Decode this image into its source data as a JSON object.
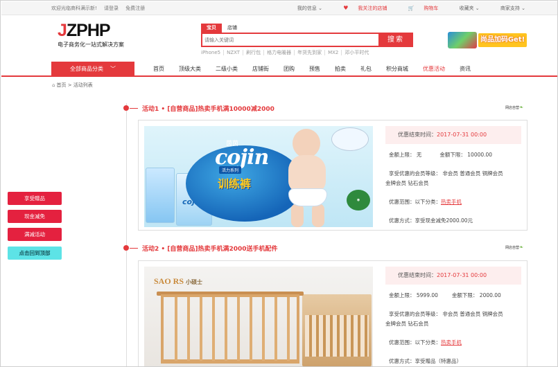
{
  "topbar": {
    "welcome": "欢迎光临商科满示新!",
    "login": "请登录",
    "register": "免费注册",
    "my_info": "我的信息",
    "followed_shops": "我关注的店铺",
    "cart": "购物车",
    "favorites": "收藏夹",
    "seller_center": "商家支持"
  },
  "header": {
    "logo_j": "J",
    "logo_rest": "ZPHP",
    "slogan": "电子商务化一站式解决方案",
    "search_tabs": [
      "宝贝",
      "店铺"
    ],
    "search_placeholder": "请输入关键词",
    "search_button": "搜索",
    "hot_words": [
      "iPhone5",
      "NZXT",
      "刷行包",
      "格力电暖器",
      "年货先到家",
      "MX2",
      "邓小平时代"
    ],
    "banner_text": "尚品加码Get!"
  },
  "nav": {
    "all_categories": "全部商品分类",
    "items": [
      "首页",
      "顶级大类",
      "二级小类",
      "店铺街",
      "团购",
      "预售",
      "拍卖",
      "礼包",
      "积分商城",
      "优惠活动",
      "资讯"
    ],
    "active_index": 9
  },
  "breadcrumb": {
    "home": "首页",
    "separator": ">",
    "current": "活动列表"
  },
  "side_menu": [
    "享受赠品",
    "现金减免",
    "满减活动",
    "点击回到顶部"
  ],
  "activities": [
    {
      "title": "活动1 •  [自营商品]热卖手机满10000减2000",
      "shop_tag": "网店自营",
      "end_time_label": "优惠结束时间：",
      "end_time": "2017-07-31 00:00",
      "limit_upper_label": "金额上限：",
      "limit_upper": "无",
      "limit_lower_label": "金额下限：",
      "limit_lower": "10000.00",
      "member_label": "享受优惠的会员等级：",
      "members_line1": "非会员   普通会员   铜牌会员",
      "members_line2": "金牌会员   钻石会员",
      "scope_label": "优惠范围：以下分类：",
      "scope_link": "热卖手机",
      "method_label": "优惠方式：",
      "method": "享受现金减免2000.00元",
      "image": {
        "brand": "cojin",
        "brand_cn": "茵茵",
        "headline": "训练裤",
        "series": "活力系列"
      }
    },
    {
      "title": "活动2 •  [自营商品]热卖手机满2000送手机配件",
      "shop_tag": "网店自营",
      "end_time_label": "优惠结束时间：",
      "end_time": "2017-07-31 00:00",
      "limit_upper_label": "金额上限：",
      "limit_upper": "5999.00",
      "limit_lower_label": "金额下限：",
      "limit_lower": "2000.00",
      "member_label": "享受优惠的会员等级：",
      "members_line1": "非会员   普通会员   铜牌会员",
      "members_line2": "金牌会员   钻石会员",
      "scope_label": "优惠范围：以下分类：",
      "scope_link": "热卖手机",
      "method_label": "优惠方式：",
      "method": "享受赠品（特惠品）",
      "image": {
        "brand": "SAO RS",
        "brand_cn": "小硕士"
      }
    }
  ],
  "colors": {
    "accent": "#e4393c",
    "teal": "#5de3e6",
    "tint": "#fdeeee"
  }
}
